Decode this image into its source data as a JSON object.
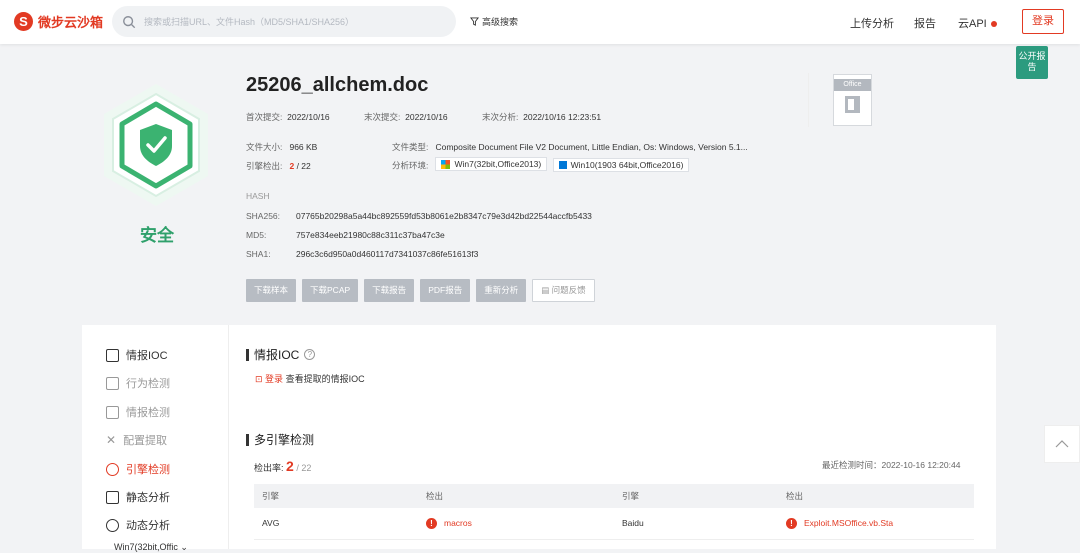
{
  "header": {
    "logo_text": "微步云沙箱",
    "search_placeholder": "搜索或扫描URL、文件Hash（MD5/SHA1/SHA256）",
    "advanced_search": "高级搜索",
    "nav": [
      "上传分析",
      "报告",
      "云API"
    ],
    "login": "登录",
    "brand_color": "#e23a23"
  },
  "public_tag": "公开报告",
  "verdict": {
    "label": "安全",
    "color": "#2fa06b"
  },
  "file": {
    "name": "25206_allchem.doc",
    "first_submit_label": "首次提交:",
    "first_submit": "2022/10/16",
    "last_submit_label": "末次提交:",
    "last_submit": "2022/10/16",
    "last_analysis_label": "末次分析:",
    "last_analysis": "2022/10/16 12:23:51",
    "size_label": "文件大小:",
    "size": "966 KB",
    "type_label": "文件类型:",
    "type": "Composite Document File V2 Document, Little Endian, Os: Windows, Version 5.1...",
    "engine_label": "引擎检出:",
    "engine_hits": "2",
    "engine_total": "/ 22",
    "env_label": "分析环境:",
    "envs": [
      "Win7(32bit,Office2013)",
      "Win10(1903 64bit,Office2016)"
    ],
    "type_icon": "Office"
  },
  "hash": {
    "title": "HASH",
    "sha256_label": "SHA256:",
    "sha256": "07765b20298a5a44bc892559fd53b8061e2b8347c79e3d42bd22544accfb5433",
    "md5_label": "MD5:",
    "md5": "757e834eeb21980c88c311c37ba47c3e",
    "sha1_label": "SHA1:",
    "sha1": "296c3c6d950a0d460117d7341037c86fe51613f3"
  },
  "actions": [
    "下载样本",
    "下载PCAP",
    "下载报告",
    "PDF报告",
    "重新分析",
    "问题反馈"
  ],
  "sidebar": {
    "items": [
      "情报IOC",
      "行为检测",
      "情报检测",
      "配置提取",
      "引擎检测",
      "静态分析",
      "动态分析"
    ],
    "env_sub": "Win7(32bit,Offic"
  },
  "ioc": {
    "title": "情报IOC",
    "login_link": "登录",
    "login_text": "查看提取的情报IOC"
  },
  "engines": {
    "title": "多引擎检测",
    "rate_label": "检出率:",
    "hits": "2",
    "total": "/ 22",
    "last_time": "最近检测时间：2022-10-16 12:20:44",
    "headers": [
      "引擎",
      "检出",
      "引擎",
      "检出"
    ],
    "rows": [
      {
        "engine1": "AVG",
        "result1": "macros",
        "engine2": "Baidu",
        "result2": "Exploit.MSOffice.vb.Sta"
      }
    ]
  }
}
